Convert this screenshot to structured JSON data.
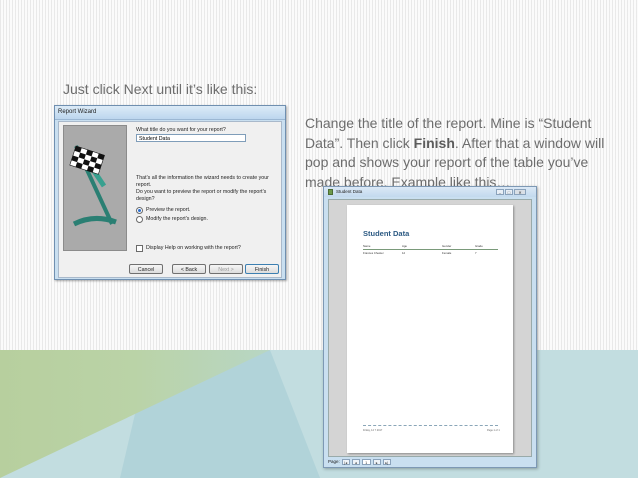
{
  "slide": {
    "caption_1": "Just click Next until it’s like this:",
    "instructions": {
      "part1": "Change the title of the report. Mine is “Student Data”. Then click ",
      "bold": "Finish",
      "part2": ". After that a window will pop and shows your report of the table you’ve made before. Example like this…"
    }
  },
  "wizard": {
    "title": "Report Wizard",
    "question": "What title do you want for your report?",
    "title_value": "Student Data",
    "info": "That's all the information the wizard needs to create your report.",
    "preview_question": "Do you want to preview the report or modify the report's design?",
    "option_preview": "Preview the report.",
    "option_modify": "Modify the report's design.",
    "help_checkbox": "Display Help on working with the report?",
    "buttons": {
      "cancel": "Cancel",
      "back": "< Back",
      "next": "Next >",
      "finish": "Finish"
    }
  },
  "preview": {
    "window_title": "Student Data",
    "report_title": "Student Data",
    "columns": [
      "Name",
      "Age",
      "Gender",
      "Grade"
    ],
    "row": [
      "Frances Chester",
      "12",
      "Female",
      "7"
    ],
    "footer_left": "Friday, 14 7 2017",
    "footer_right": "Page 1 of 1",
    "status_label": "Page:",
    "page_number": "1",
    "controls": {
      "minimize": "–",
      "maximize": "□",
      "close": "✕"
    },
    "nav": {
      "first": "|◂",
      "prev": "◂",
      "next": "▸",
      "last": "▸|"
    }
  },
  "colors": {
    "band_teal": "#c2dde0",
    "band_green": "#b7cf9e",
    "report_title": "#2c5a83",
    "text_gray": "#6d6d6d"
  }
}
